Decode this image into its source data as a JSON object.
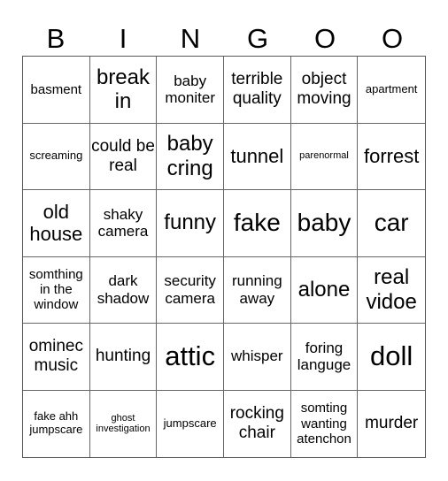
{
  "header": {
    "letters": [
      "B",
      "I",
      "N",
      "G",
      "O",
      "O"
    ]
  },
  "cells": [
    "basment",
    "break in",
    "baby moniter",
    "terrible quality",
    "object moving",
    "apartment",
    "screaming",
    "could be real",
    "baby cring",
    "tunnel",
    "parenormal",
    "forrest",
    "old house",
    "shaky camera",
    "funny",
    "fake",
    "baby",
    "car",
    "somthing in the window",
    "dark shadow",
    "security camera",
    "running away",
    "alone",
    "real vidoe",
    "ominec music",
    "hunting",
    "attic",
    "whisper",
    "foring languge",
    "doll",
    "fake ahh jumpscare",
    "ghost investigation",
    "jumpscare",
    "rocking chair",
    "somting wanting atenchon",
    "murder"
  ]
}
